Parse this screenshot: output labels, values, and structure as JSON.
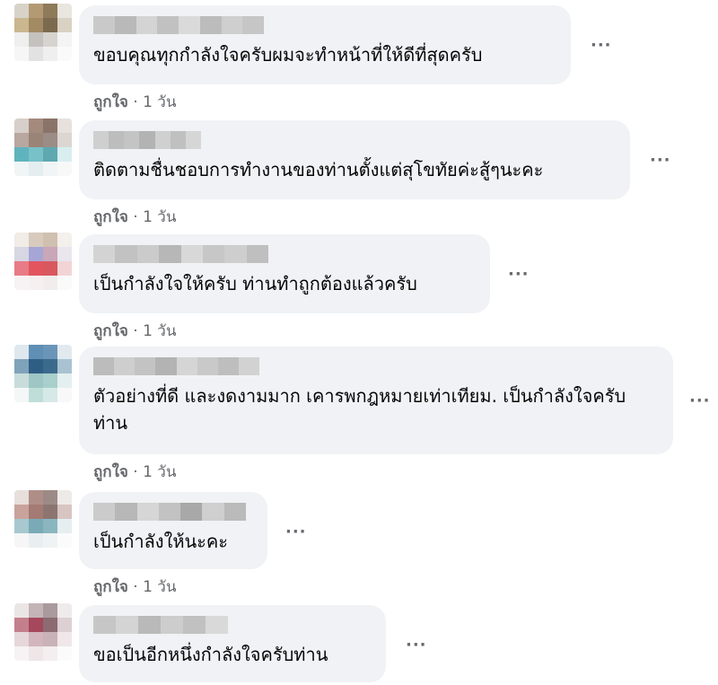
{
  "comments": [
    {
      "text": "ขอบคุณทุกกำลังใจครับผมจะทำหน้าที่ให้ดีที่สุดครับ",
      "like": "ถูกใจ",
      "sep": "·",
      "time": "1 วัน",
      "more": "···",
      "avatar_colors": [
        "#d8d3c9",
        "#b49a73",
        "#8f7a5a",
        "#e9e6e0",
        "#cab78f",
        "#a28a62",
        "#7b6a4f",
        "#d9d1c2",
        "#efefef",
        "#c4c2bf",
        "#d7d4cf",
        "#f4f4f4",
        "#f6f6f6",
        "#e2e2e2",
        "#efefef",
        "#fafafa"
      ],
      "name_colors": [
        "#c9c9c9",
        "#b9b9b9",
        "#d4d4d4",
        "#c1c1c1",
        "#dadada",
        "#bcbcbc",
        "#cfcfcf",
        "#c6c6c6"
      ]
    },
    {
      "text": "ติดตามชื่นชอบการทำงานของท่านตั้งแต่สุโขทัยค่ะสู้ๆนะคะ",
      "like": "ถูกใจ",
      "sep": "·",
      "time": "1 วัน",
      "more": "···",
      "avatar_colors": [
        "#d7cfc9",
        "#a48a7c",
        "#8a7469",
        "#e6e1dd",
        "#b8a79f",
        "#9a8478",
        "#9b8c86",
        "#dcd6d2",
        "#5fb3be",
        "#78c1c9",
        "#5ea8b0",
        "#d9eef0",
        "#f0f5f6",
        "#e4eef0",
        "#f1f5f6",
        "#f8f8f8"
      ],
      "name_colors": [
        "#cfcfcf",
        "#bdbdbd",
        "#c4c4c4",
        "#b3b3b3",
        "#d0d0d0",
        "#c0c0c0",
        "#d6d6d6"
      ]
    },
    {
      "text": "เป็นกำลังใจให้ครับ ท่านทำถูกต้องแล้วครับ",
      "like": "ถูกใจ",
      "sep": "·",
      "time": "1 วัน",
      "more": "···",
      "avatar_colors": [
        "#f1ece6",
        "#d8cbbd",
        "#cfc0b0",
        "#f4f0ec",
        "#d7d7e3",
        "#a5a6d6",
        "#c9a6b8",
        "#e9e6ee",
        "#e87b86",
        "#e2555f",
        "#d7585f",
        "#f3d4d6",
        "#f7f3f4",
        "#f6f0f0",
        "#f2eded",
        "#fafafa"
      ],
      "name_colors": [
        "#d3d3d3",
        "#c2c2c2",
        "#cbcbcb",
        "#b7b7b7",
        "#d8d8d8",
        "#c7c7c7",
        "#cecece",
        "#bfbfbf"
      ]
    },
    {
      "text": "ตัวอย่างที่ดี และงดงามมาก เคารพกฎหมายเท่าเทียม. เป็นกำลังใจครับท่าน",
      "like": "ถูกใจ",
      "sep": "·",
      "time": "1 วัน",
      "more": "···",
      "avatar_colors": [
        "#dfe8ee",
        "#5f8fb5",
        "#6b95b8",
        "#e2eaf0",
        "#7fa3b9",
        "#2f5e85",
        "#3c6a8c",
        "#a9c2d1",
        "#c8dcdc",
        "#9ec6c4",
        "#a8cfcc",
        "#e4efef",
        "#f4f7f7",
        "#bfded9",
        "#d6e9e7",
        "#f8f8f8"
      ],
      "name_colors": [
        "#bcbcbc",
        "#cecece",
        "#c3c3c3",
        "#b3b3b3",
        "#d5d5d5",
        "#c9c9c9",
        "#bebebe",
        "#d2d2d2"
      ]
    },
    {
      "text": "เป็นกำลังให้นะคะ",
      "like": "ถูกใจ",
      "sep": "·",
      "time": "1 วัน",
      "more": "···",
      "avatar_colors": [
        "#e6dfdb",
        "#b08e88",
        "#9c8a86",
        "#eeeae8",
        "#c9a39c",
        "#a47a74",
        "#8c7571",
        "#d8c5c2",
        "#a7c8cf",
        "#79aab6",
        "#8bb6bf",
        "#e6eef0",
        "#f6f6f6",
        "#e9eff1",
        "#eff3f4",
        "#fbfbfb"
      ],
      "name_colors": [
        "#cbcbcb",
        "#b7b7b7",
        "#d6d6d6",
        "#c2c2c2",
        "#a8a8a8",
        "#cfcfcf",
        "#bababa"
      ]
    },
    {
      "text": "ขอเป็นอีกหนึ่งกำลังใจครับท่าน",
      "like": "ถูกใจ",
      "sep": "·",
      "time": "1 วัน",
      "more": "···",
      "avatar_colors": [
        "#ebe6e6",
        "#c3b4b6",
        "#a99a9d",
        "#efebec",
        "#c47f8d",
        "#a5485c",
        "#8c6b72",
        "#dcd0d3",
        "#e6d7db",
        "#d3b5bd",
        "#c9b2b8",
        "#efe7e9",
        "#f7f3f4",
        "#efe6e8",
        "#f3eef0",
        "#fbfbfb"
      ],
      "name_colors": [
        "#c6c6c6",
        "#d4d4d4",
        "#b9b9b9",
        "#cdcdcd",
        "#c1c1c1",
        "#d9d9d9"
      ]
    }
  ]
}
